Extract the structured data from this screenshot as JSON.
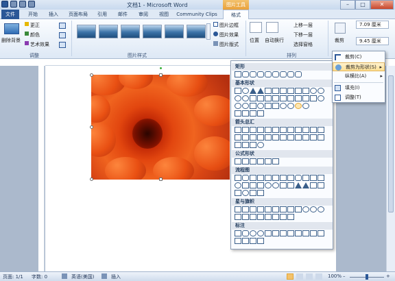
{
  "titlebar": {
    "title": "文档1 - Microsoft Word",
    "context_tab": "图片工具"
  },
  "window": {
    "minimize": "–",
    "maximize": "□",
    "close": "✕"
  },
  "tabs": [
    "文件",
    "开始",
    "插入",
    "页面布局",
    "引用",
    "邮件",
    "审阅",
    "视图",
    "Community Clips",
    "格式"
  ],
  "ribbon": {
    "remove_bg": "删除背景",
    "corrections": "更正",
    "color": "颜色",
    "artistic": "艺术效果",
    "adjust_group": "调整",
    "styles_group": "图片样式",
    "picture_border": "图片边框",
    "picture_effects": "图片效果",
    "picture_layout": "图片版式",
    "position": "位置",
    "wrap_text": "自动换行",
    "bring_forward": "上移一层",
    "send_backward": "下移一层",
    "selection_pane": "选择窗格",
    "arrange_group": "排列",
    "crop": "裁剪",
    "height": "7.09 厘米",
    "width": "9.45 厘米"
  },
  "menu": {
    "items": [
      "裁剪(C)",
      "裁剪为形状(S)",
      "纵横比(A)",
      "填充(I)",
      "调整(T)"
    ]
  },
  "shapes": {
    "sections": [
      "矩形",
      "基本形状",
      "箭头总汇",
      "公式形状",
      "流程图",
      "星与旗帜",
      "标注"
    ]
  },
  "status": {
    "page": "页面: 1/1",
    "words": "字数: 0",
    "language": "英语(美国)",
    "insert": "插入",
    "zoom": "100%"
  },
  "colors": {
    "accent": "#2b5797",
    "context": "#e9a13b",
    "flower": "#e2460f"
  }
}
